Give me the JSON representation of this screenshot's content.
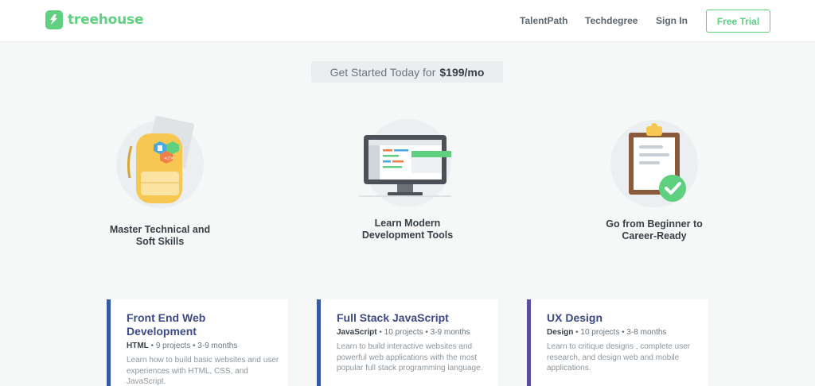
{
  "nav": {
    "logo_text": "treehouse",
    "links": [
      "TalentPath",
      "Techdegree",
      "Sign In"
    ],
    "cta": "Free Trial"
  },
  "pricing": {
    "prefix": "Get Started Today for",
    "price": "$199/mo"
  },
  "features": [
    {
      "line1": "Master Technical and",
      "line2": "Soft Skills",
      "icon": "backpack-icon"
    },
    {
      "line1": "Learn Modern",
      "line2": "Development Tools",
      "icon": "monitor-icon"
    },
    {
      "line1": "Go from Beginner to",
      "line2": "Career-Ready",
      "icon": "clipboard-check-icon"
    }
  ],
  "tracks": [
    {
      "title": "Front End Web Development",
      "lang": "HTML",
      "projects": "9 projects",
      "duration": "3-9 months",
      "description": "Learn how to build basic websites and user experiences with HTML, CSS, and JavaScript.",
      "accent": "#3659a2"
    },
    {
      "title": "Full Stack JavaScript",
      "lang": "JavaScript",
      "projects": "10 projects",
      "duration": "3-9 months",
      "description": "Learn to build interactive websites and powerful web applications with the most popular full stack programming language.",
      "accent": "#3659a2"
    },
    {
      "title": "UX Design",
      "lang": "Design",
      "projects": "10 projects",
      "duration": "3-8 months",
      "description": "Learn to critique designs , complete user research, and design web and mobile applications.",
      "accent": "#5a4ea0"
    }
  ],
  "colors": {
    "brand": "#5fcf80",
    "title": "#3c4a87",
    "nav_text": "#5b6770"
  }
}
